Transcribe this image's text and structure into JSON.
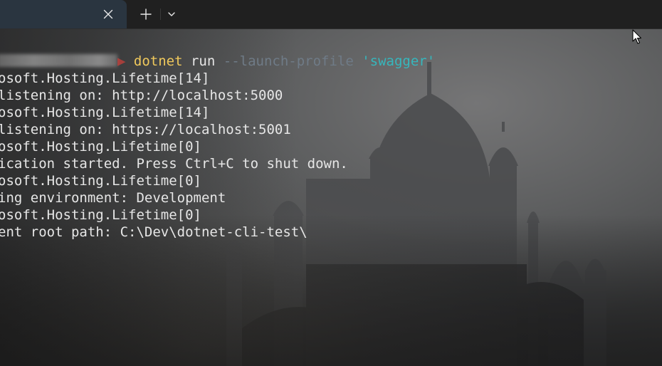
{
  "tabbar": {
    "close_icon": "close-icon",
    "new_tab_icon": "plus-icon",
    "dropdown_icon": "chevron-down-icon",
    "tab_bg": "#2a3540"
  },
  "terminal": {
    "prompt": {
      "arrow": "▶",
      "command": "dotnet",
      "subcommand": " run ",
      "option": "--launch-profile",
      "argument": "'swagger'"
    },
    "output_lines": [
      "osoft.Hosting.Lifetime[14]",
      "listening on: http://localhost:5000",
      "osoft.Hosting.Lifetime[14]",
      "listening on: https://localhost:5001",
      "osoft.Hosting.Lifetime[0]",
      "ication started. Press Ctrl+C to shut down.",
      "osoft.Hosting.Lifetime[0]",
      "ing environment: Development",
      "osoft.Hosting.Lifetime[0]",
      "ent root path: C:\\Dev\\dotnet-cli-test\\"
    ],
    "colors": {
      "command": "#f0c95c",
      "option": "#6f7b87",
      "argument": "#36b7bd",
      "text": "#e6e6e6"
    }
  }
}
